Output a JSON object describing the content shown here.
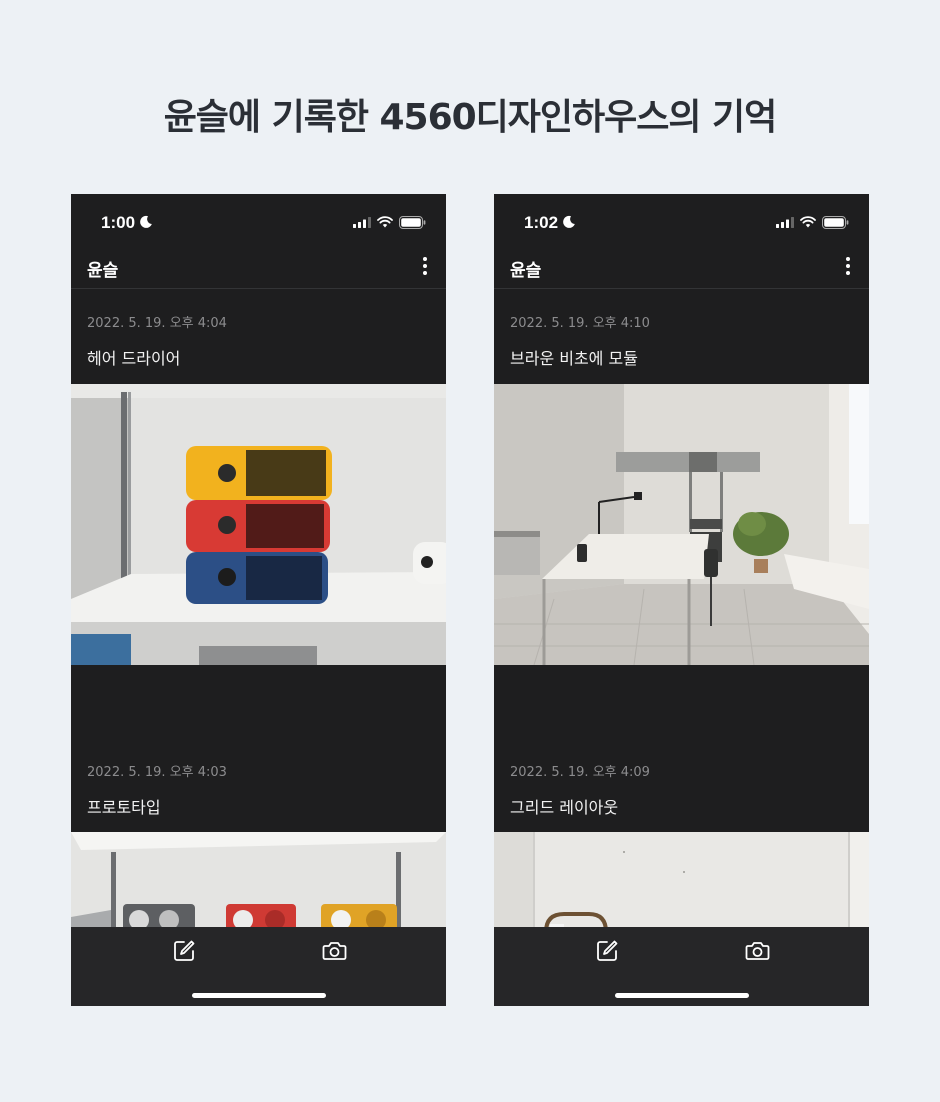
{
  "headline": "윤슬에 기록한 4560디자인하우스의 기억",
  "phones": [
    {
      "status_time": "1:00",
      "app_title": "윤슬",
      "entries": [
        {
          "timestamp": "2022. 5. 19. 오후 4:04",
          "title": "헤어 드라이어"
        },
        {
          "timestamp": "2022. 5. 19. 오후 4:03",
          "title": "프로토타입"
        }
      ]
    },
    {
      "status_time": "1:02",
      "app_title": "윤슬",
      "entries": [
        {
          "timestamp": "2022. 5. 19. 오후 4:10",
          "title": "브라운 비초에 모듈"
        },
        {
          "timestamp": "2022. 5. 19. 오후 4:09",
          "title": "그리드 레이아웃"
        }
      ]
    }
  ],
  "icons": {
    "status": [
      "moon-icon",
      "cellular-signal-icon",
      "wifi-icon",
      "battery-icon"
    ],
    "appbar": [
      "more-vertical-icon"
    ],
    "toolbar": [
      "compose-icon",
      "camera-icon"
    ]
  },
  "colors": {
    "page_background": "#edf1f5",
    "app_background": "#1e1e1f",
    "toolbar_background": "#262628",
    "headline_text": "#2b2f36",
    "timestamp_text": "#8c8c8e"
  }
}
